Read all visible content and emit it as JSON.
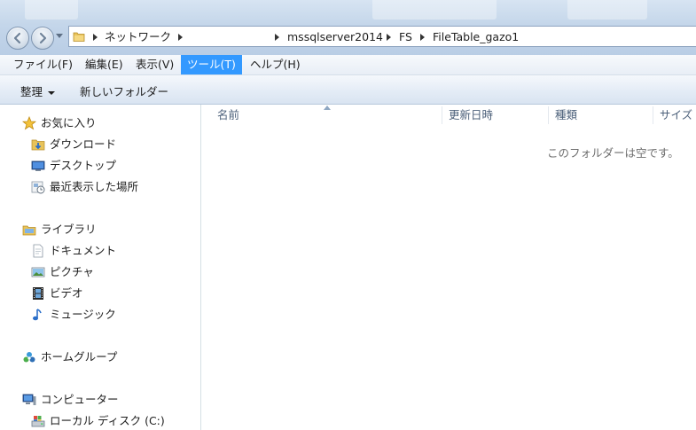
{
  "address": {
    "crumbs": [
      "ネットワーク",
      "mssqlserver2014",
      "FS",
      "FileTable_gazo1"
    ]
  },
  "menu": {
    "items": [
      "ファイル(F)",
      "編集(E)",
      "表示(V)",
      "ツール(T)",
      "ヘルプ(H)"
    ],
    "active_index": 3
  },
  "commands": {
    "organize": "整理",
    "new_folder": "新しいフォルダー"
  },
  "nav": {
    "favorites": {
      "label": "お気に入り",
      "items": [
        "ダウンロード",
        "デスクトップ",
        "最近表示した場所"
      ]
    },
    "libraries": {
      "label": "ライブラリ",
      "items": [
        "ドキュメント",
        "ピクチャ",
        "ビデオ",
        "ミュージック"
      ]
    },
    "homegroup": {
      "label": "ホームグループ"
    },
    "computer": {
      "label": "コンピューター",
      "items": [
        "ローカル ディスク (C:)"
      ]
    }
  },
  "columns": [
    "名前",
    "更新日時",
    "種類",
    "サイズ"
  ],
  "empty_message": "このフォルダーは空です。",
  "colors": {
    "menu_highlight": "#3399ff",
    "header_text": "#4c607a",
    "empty_text": "#6d6d6d"
  }
}
